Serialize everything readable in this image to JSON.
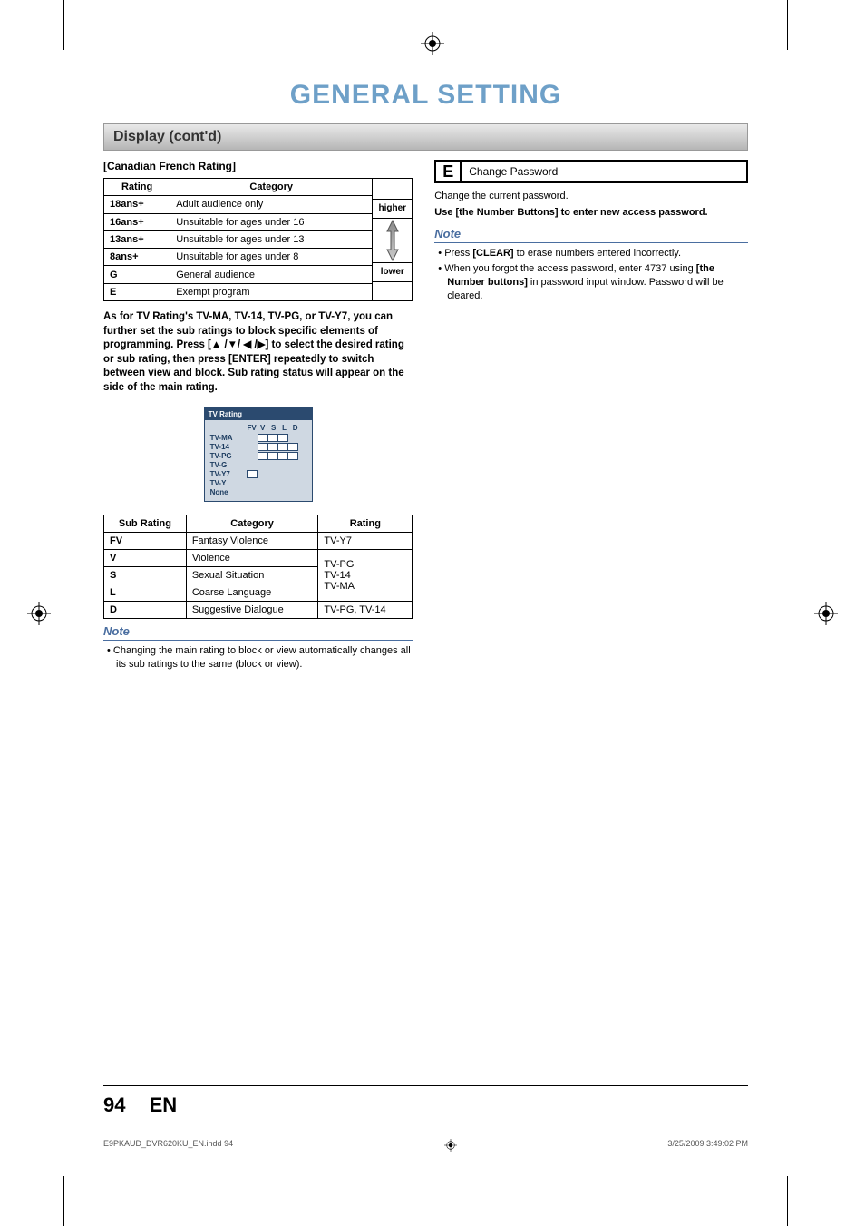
{
  "page_title": "GENERAL SETTING",
  "section_bar": "Display (cont'd)",
  "canadian_french_heading": "[Canadian French Rating]",
  "canadian_french_table": {
    "headers": [
      "Rating",
      "Category"
    ],
    "rows": [
      {
        "rating": "18ans+",
        "category": "Adult audience only"
      },
      {
        "rating": "16ans+",
        "category": "Unsuitable for ages under 16"
      },
      {
        "rating": "13ans+",
        "category": "Unsuitable for ages under 13"
      },
      {
        "rating": "8ans+",
        "category": "Unsuitable for ages under 8"
      },
      {
        "rating": "G",
        "category": "General audience"
      },
      {
        "rating": "E",
        "category": "Exempt program"
      }
    ],
    "scale_top": "higher",
    "scale_bottom": "lower"
  },
  "bold_paragraph": "As for TV Rating's TV-MA, TV-14, TV-PG, or TV-Y7, you can further set the sub ratings to block specific elements of programming. Press [▲ /▼/ ◀ /▶] to select the desired rating or sub rating, then press [ENTER] repeatedly to switch between view and block. Sub rating status will appear on the side of the main rating.",
  "tv_rating_box": {
    "title": "TV Rating",
    "cols": [
      "FV",
      "V",
      "S",
      "L",
      "D"
    ],
    "rows": [
      {
        "label": "TV-MA",
        "pattern": [
          0,
          1,
          1,
          1,
          0
        ]
      },
      {
        "label": "TV-14",
        "pattern": [
          0,
          1,
          1,
          1,
          1
        ]
      },
      {
        "label": "TV-PG",
        "pattern": [
          0,
          1,
          1,
          1,
          1
        ]
      },
      {
        "label": "TV-G",
        "pattern": [
          0,
          0,
          0,
          0,
          0
        ]
      },
      {
        "label": "TV-Y7",
        "pattern": [
          1,
          0,
          0,
          0,
          0
        ]
      },
      {
        "label": "TV-Y",
        "pattern": [
          0,
          0,
          0,
          0,
          0
        ]
      },
      {
        "label": "None",
        "pattern": [
          0,
          0,
          0,
          0,
          0
        ]
      }
    ]
  },
  "sub_rating_table": {
    "headers": [
      "Sub Rating",
      "Category",
      "Rating"
    ],
    "rows": [
      {
        "sub": "FV",
        "cat": "Fantasy Violence",
        "rating": "TV-Y7"
      },
      {
        "sub": "V",
        "cat": "Violence",
        "rating": ""
      },
      {
        "sub": "S",
        "cat": "Sexual Situation",
        "rating": ""
      },
      {
        "sub": "L",
        "cat": "Coarse Language",
        "rating": ""
      },
      {
        "sub": "D",
        "cat": "Suggestive Dialogue",
        "rating": "TV-PG, TV-14"
      }
    ],
    "merged_rating_vs_l": "TV-PG\nTV-14\nTV-MA"
  },
  "note_left": {
    "title": "Note",
    "items": [
      "Changing the main rating to block or view automatically changes all its sub ratings to the same (block or view)."
    ]
  },
  "option_e": {
    "letter": "E",
    "label": "Change Password"
  },
  "change_desc": "Change the current password.",
  "use_number": "Use [the Number Buttons] to enter new access password.",
  "note_right": {
    "title": "Note",
    "items": [
      "Press [CLEAR] to erase numbers entered incorrectly.",
      "When you forgot the access password, enter 4737 using [the Number buttons] in password input window. Password will be cleared."
    ]
  },
  "footer": {
    "page": "94",
    "lang": "EN"
  },
  "printline": {
    "file": "E9PKAUD_DVR620KU_EN.indd   94",
    "timestamp": "3/25/2009   3:49:02 PM"
  },
  "chart_data": [
    {
      "type": "table",
      "title": "Canadian French Rating",
      "columns": [
        "Rating",
        "Category"
      ],
      "rows": [
        [
          "18ans+",
          "Adult audience only"
        ],
        [
          "16ans+",
          "Unsuitable for ages under 16"
        ],
        [
          "13ans+",
          "Unsuitable for ages under 13"
        ],
        [
          "8ans+",
          "Unsuitable for ages under 8"
        ],
        [
          "G",
          "General audience"
        ],
        [
          "E",
          "Exempt program"
        ]
      ],
      "scale": {
        "top": "higher",
        "bottom": "lower"
      }
    },
    {
      "type": "table",
      "title": "Sub Rating",
      "columns": [
        "Sub Rating",
        "Category",
        "Rating"
      ],
      "rows": [
        [
          "FV",
          "Fantasy Violence",
          "TV-Y7"
        ],
        [
          "V",
          "Violence",
          "TV-PG / TV-14 / TV-MA"
        ],
        [
          "S",
          "Sexual Situation",
          "TV-PG / TV-14 / TV-MA"
        ],
        [
          "L",
          "Coarse Language",
          "TV-PG / TV-14 / TV-MA"
        ],
        [
          "D",
          "Suggestive Dialogue",
          "TV-PG, TV-14"
        ]
      ]
    }
  ]
}
